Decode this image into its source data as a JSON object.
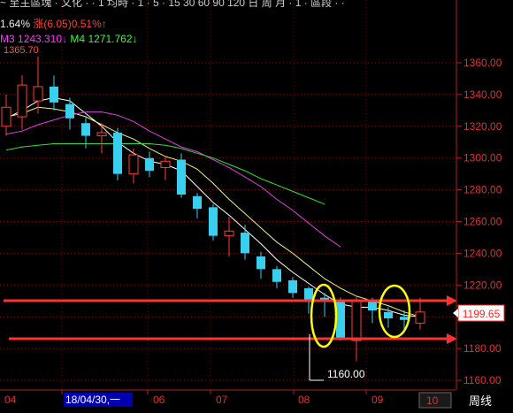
{
  "header": {
    "top_clipped": "~ 至主區塊 · 文化 · · 1 均時 · 1 · 5 · 15 30 60 90 120 日 周 月 · 1 · 區段 · ·",
    "change_pct": "1.64%",
    "change_label": "涨(6.05)",
    "change_pct2": "0.51%↑",
    "ma3_label": "M3",
    "ma3_value": "1243.310↓",
    "ma4_label": "M4",
    "ma4_value": "1271.762↓",
    "clipped_high": "1365.70"
  },
  "axis_bottom": {
    "labels": [
      "04",
      "18/04/30,一",
      "06",
      "07",
      "08",
      "09"
    ],
    "right_box": "10",
    "period": "周线"
  },
  "annotations": {
    "current_price": "1199.65",
    "low_label": "1160.00"
  },
  "colors": {
    "up": "#ff3b3b",
    "down": "#39d0f0",
    "ma_white": "#ffffff",
    "ma_yellow": "#f0f080",
    "ma_magenta": "#e040e0",
    "ma_green": "#30e030",
    "hline": "#ff3030",
    "circle": "#ffff00"
  },
  "chart_data": {
    "type": "candlestick",
    "title": "",
    "ylim": [
      1150,
      1380
    ],
    "yticks": [
      1160,
      1180,
      1200,
      1220,
      1240,
      1260,
      1280,
      1300,
      1320,
      1340,
      1360
    ],
    "candles": [
      {
        "o": 1320,
        "c": 1332,
        "h": 1340,
        "l": 1314
      },
      {
        "o": 1326,
        "c": 1346,
        "h": 1352,
        "l": 1318
      },
      {
        "o": 1336,
        "c": 1345,
        "h": 1364,
        "l": 1328
      },
      {
        "o": 1345,
        "c": 1335,
        "h": 1352,
        "l": 1330
      },
      {
        "o": 1334,
        "c": 1325,
        "h": 1338,
        "l": 1318
      },
      {
        "o": 1322,
        "c": 1314,
        "h": 1326,
        "l": 1306
      },
      {
        "o": 1314,
        "c": 1316,
        "h": 1322,
        "l": 1303
      },
      {
        "o": 1316,
        "c": 1290,
        "h": 1319,
        "l": 1286
      },
      {
        "o": 1290,
        "c": 1302,
        "h": 1306,
        "l": 1284
      },
      {
        "o": 1300,
        "c": 1292,
        "h": 1304,
        "l": 1288
      },
      {
        "o": 1294,
        "c": 1298,
        "h": 1301,
        "l": 1286
      },
      {
        "o": 1299,
        "c": 1277,
        "h": 1303,
        "l": 1275
      },
      {
        "o": 1276,
        "c": 1268,
        "h": 1278,
        "l": 1262
      },
      {
        "o": 1269,
        "c": 1251,
        "h": 1271,
        "l": 1248
      },
      {
        "o": 1251,
        "c": 1254,
        "h": 1263,
        "l": 1238
      },
      {
        "o": 1253,
        "c": 1240,
        "h": 1258,
        "l": 1236
      },
      {
        "o": 1238,
        "c": 1230,
        "h": 1241,
        "l": 1224
      },
      {
        "o": 1230,
        "c": 1222,
        "h": 1232,
        "l": 1218
      },
      {
        "o": 1223,
        "c": 1215,
        "h": 1225,
        "l": 1212
      },
      {
        "o": 1218,
        "c": 1210,
        "h": 1219,
        "l": 1202
      },
      {
        "o": 1212,
        "c": 1210,
        "h": 1215,
        "l": 1200
      },
      {
        "o": 1210,
        "c": 1186,
        "h": 1212,
        "l": 1185
      },
      {
        "o": 1185,
        "c": 1210,
        "h": 1213,
        "l": 1172
      },
      {
        "o": 1210,
        "c": 1204,
        "h": 1212,
        "l": 1196
      },
      {
        "o": 1203,
        "c": 1199,
        "h": 1206,
        "l": 1193
      },
      {
        "o": 1200,
        "c": 1198,
        "h": 1204,
        "l": 1192
      },
      {
        "o": 1196,
        "c": 1203,
        "h": 1212,
        "l": 1192
      }
    ],
    "ma_series": [
      {
        "color": "#ffffff",
        "values": [
          1325,
          1330,
          1336,
          1338,
          1336,
          1328,
          1320,
          1310,
          1303,
          1298,
          1296,
          1292,
          1282,
          1272,
          1264,
          1255,
          1246,
          1236,
          1228,
          1221,
          1214,
          1208,
          1206,
          1206,
          1204,
          1201,
          1200
        ]
      },
      {
        "color": "#f0f080",
        "values": [
          1326,
          1328,
          1332,
          1331,
          1329,
          1326,
          1321,
          1316,
          1312,
          1306,
          1301,
          1298,
          1293,
          1284,
          1274,
          1265,
          1256,
          1247,
          1240,
          1232,
          1224,
          1218,
          1213,
          1210,
          1207,
          1203,
          1200
        ]
      },
      {
        "color": "#e040e0",
        "values": [
          1315,
          1317,
          1321,
          1324,
          1327,
          1329,
          1329,
          1327,
          1323,
          1317,
          1312,
          1307,
          1304,
          1299,
          1294,
          1288,
          1282,
          1274,
          1267,
          1259,
          1251,
          1244
        ]
      },
      {
        "color": "#30e030",
        "values": [
          1305,
          1307,
          1308,
          1309,
          1309,
          1309,
          1309,
          1309,
          1309,
          1309,
          1308,
          1306,
          1303,
          1300,
          1296,
          1292,
          1287,
          1283,
          1279,
          1275,
          1271
        ]
      }
    ],
    "hlines": [
      1210,
      1185
    ],
    "current_price": 1199.65,
    "low_value": 1160
  }
}
